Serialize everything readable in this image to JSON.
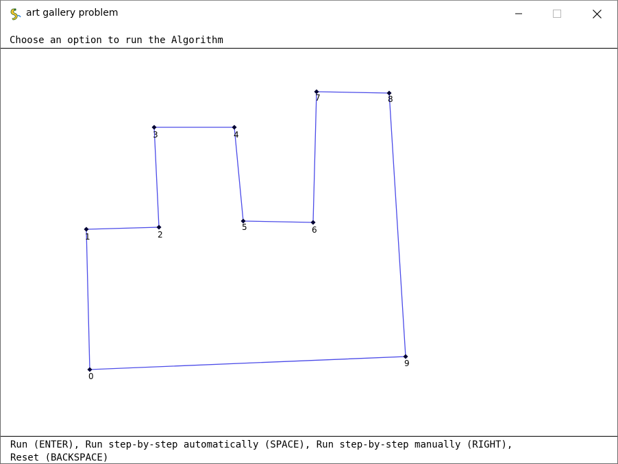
{
  "window": {
    "title": "art gallery problem",
    "app_icon": "pygame-snake-icon",
    "controls": [
      "minimize-icon",
      "maximize-icon",
      "close-icon"
    ]
  },
  "status_text": "Choose an option to run the Algorithm",
  "help_text": {
    "line1": "Run (ENTER), Run step-by-step automatically (SPACE), Run step-by-step manually (RIGHT),",
    "line2": "Reset (BACKSPACE)"
  },
  "polygon": {
    "edge_color": "#4a4ae8",
    "vertex_color": "#000033",
    "vertices": [
      {
        "label": "0"
      },
      {
        "label": "1"
      },
      {
        "label": "2"
      },
      {
        "label": "3"
      },
      {
        "label": "4"
      },
      {
        "label": "5"
      },
      {
        "label": "6"
      },
      {
        "label": "7"
      },
      {
        "label": "8"
      },
      {
        "label": "9"
      }
    ]
  }
}
